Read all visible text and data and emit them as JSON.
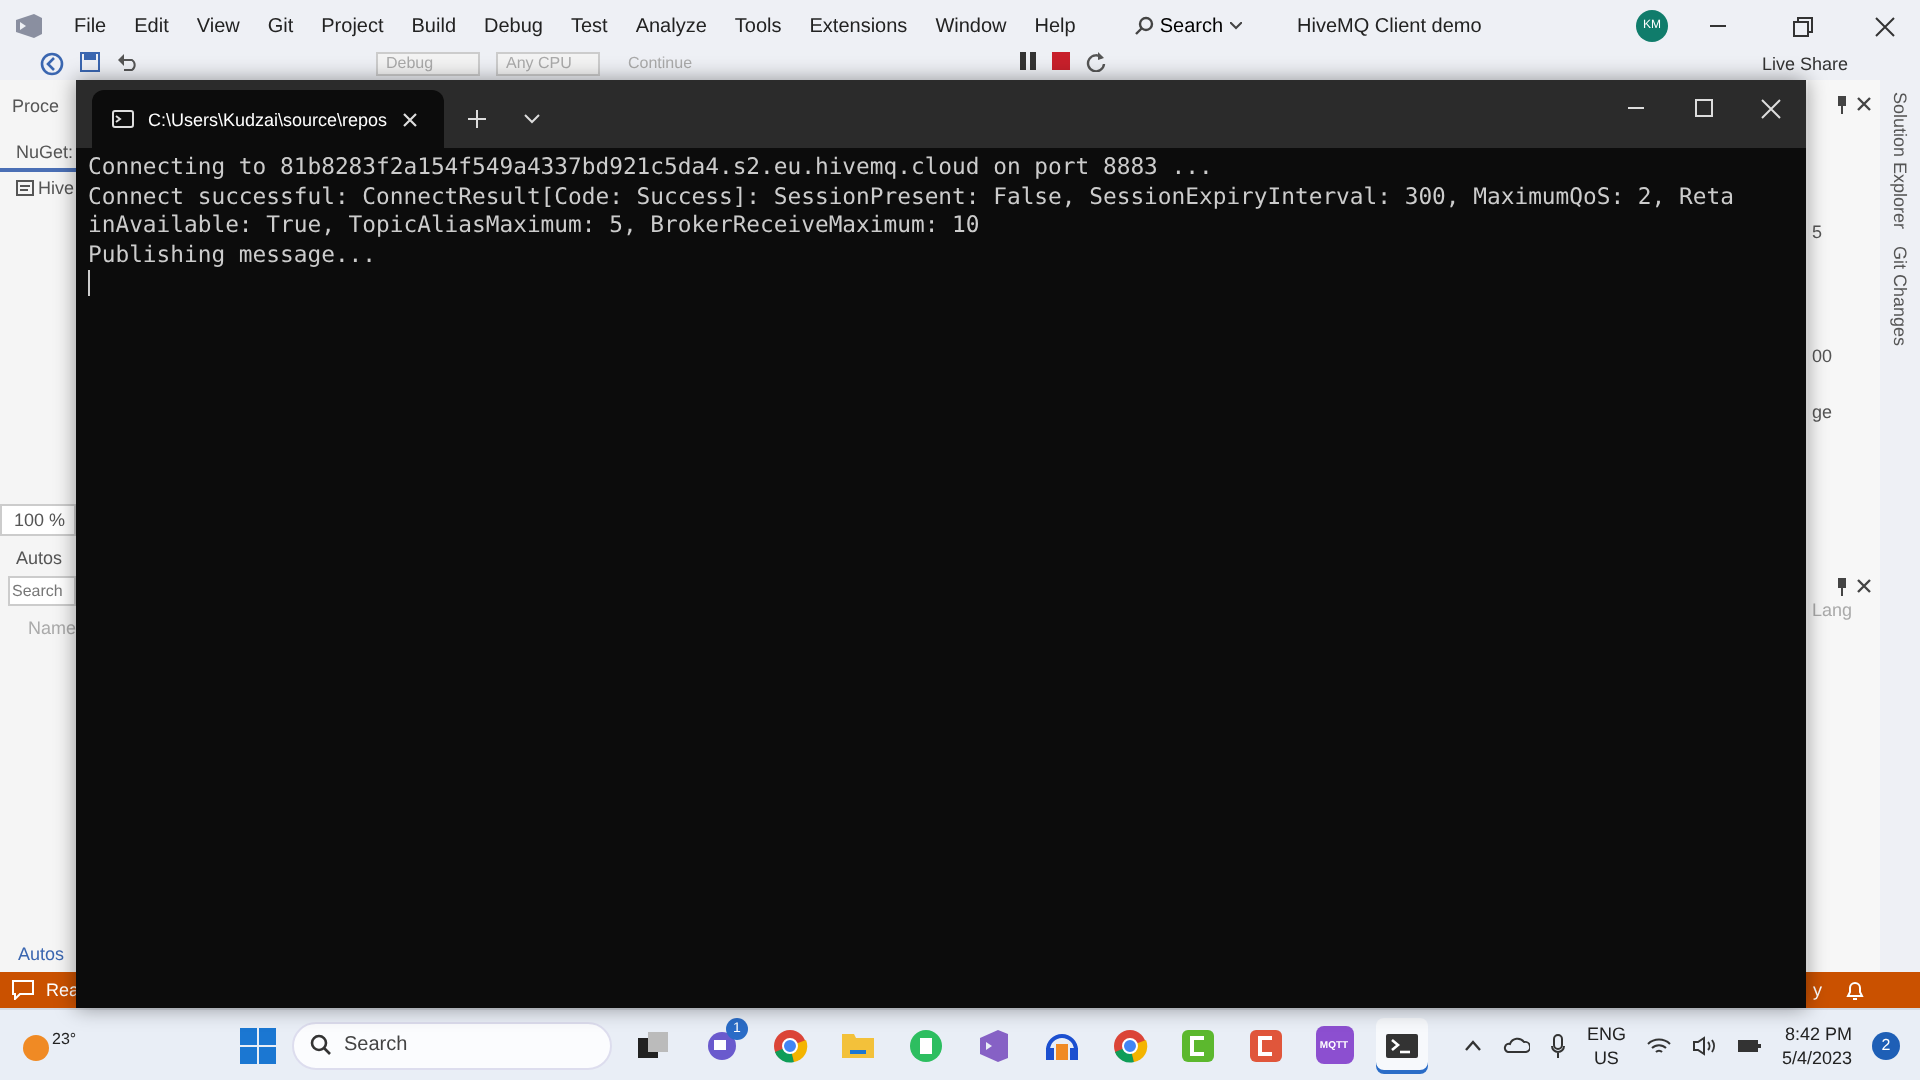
{
  "ide": {
    "menu": [
      "File",
      "Edit",
      "View",
      "Git",
      "Project",
      "Build",
      "Debug",
      "Test",
      "Analyze",
      "Tools",
      "Extensions",
      "Window",
      "Help"
    ],
    "search": "Search",
    "title": "HiveMQ Client demo",
    "avatar": "KM",
    "toolbar": {
      "configuration": "Debug",
      "platform": "Any CPU",
      "continue": "Continue",
      "live_share": "Live Share"
    },
    "left_panel": {
      "tab": "Proce",
      "nuget_tab": "NuGet:",
      "project": "Hive",
      "zoom": "100 %",
      "autos_title": "Autos",
      "search_placeholder": "Search",
      "column": "Name",
      "bottom_tab": "Autos"
    },
    "right_panel": {
      "values": [
        "5",
        "00",
        "ge"
      ],
      "column": "Lang",
      "side_tabs": [
        "Solution Explorer",
        "Git Changes"
      ]
    },
    "status_bar": {
      "left": "Rea",
      "right": "y"
    }
  },
  "terminal": {
    "tab_title": "C:\\Users\\Kudzai\\source\\repos",
    "lines": [
      "Connecting to 81b8283f2a154f549a4337bd921c5da4.s2.eu.hivemq.cloud on port 8883 ...",
      "Connect successful: ConnectResult[Code: Success]: SessionPresent: False, SessionExpiryInterval: 300, MaximumQoS: 2, Reta",
      "inAvailable: True, TopicAliasMaximum: 5, BrokerReceiveMaximum: 10",
      "Publishing message..."
    ]
  },
  "taskbar": {
    "weather": "23°",
    "search": "Search",
    "apps": [
      {
        "kind": "taskview",
        "selected": false
      },
      {
        "kind": "chat",
        "badge": "1",
        "selected": false
      },
      {
        "kind": "chrome",
        "selected": false
      },
      {
        "kind": "folder",
        "selected": false
      },
      {
        "kind": "evernote",
        "selected": false
      },
      {
        "kind": "vs",
        "selected": false
      },
      {
        "kind": "audacity",
        "selected": false
      },
      {
        "kind": "chrome",
        "selected": false
      },
      {
        "kind": "camtasia-green",
        "selected": false
      },
      {
        "kind": "camtasia-orange",
        "selected": false
      },
      {
        "kind": "mqtt",
        "label": "MQTT",
        "selected": false
      },
      {
        "kind": "terminal",
        "selected": true
      }
    ],
    "language": "ENG",
    "region": "US",
    "time": "8:42 PM",
    "date": "5/4/2023",
    "notifications": "2"
  }
}
